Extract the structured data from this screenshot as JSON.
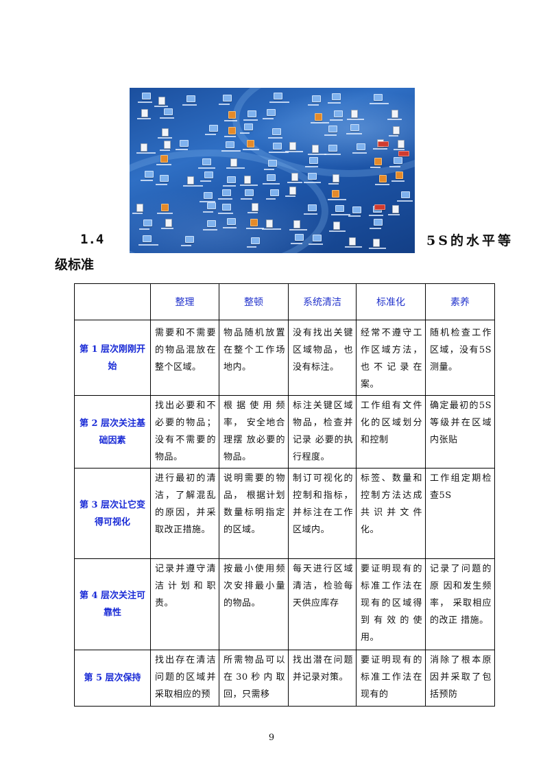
{
  "heading": {
    "number": "1.4",
    "tail": "5S的水平等",
    "line2": "级标准"
  },
  "image": {
    "title": "5S desktop screenshot"
  },
  "table": {
    "headers": [
      "",
      "整理",
      "整顿",
      "系统清洁",
      "标准化",
      "素养"
    ],
    "rows": [
      {
        "level": "第 1 层次刚刚开始",
        "cells": [
          "需要和不需要的物品混放在整个区域。",
          "物品随机放置在整个工作场地内。",
          "没有找出关键区域物品，也没有标注。",
          "经常不遵守工作区域方法，也不记录在案。",
          "随机检查工作区域，没有5S测量。"
        ]
      },
      {
        "level": "第 2 层次关注基础因素",
        "cells": [
          "找出必要和不必要的物品；没有不需要的物品。",
          "根据使用频率， 安全地合理摆 放必要的物品。",
          "标注关键区域物品，检查并记录 必要的执行程度。",
          "工作组有文件化的区域划分和控制",
          "确定最初的5S等级并在区域内张贴"
        ]
      },
      {
        "level": "第 3 层次让它变得可视化",
        "cells": [
          "进行最初的清洁，了解混乱的原因，并采取改正措施。",
          "说明需要的物品， 根据计划数量标明指定的区域。",
          "制订可视化的控制和指标，并标注在工作区域内。",
          "标签、数量和控制方法达成共识并文件化。",
          "工作组定期检查5S"
        ]
      },
      {
        "level": "第 4 层次关注可靠性",
        "cells": [
          "记录并遵守清洁计划和职责。",
          "按最小使用频次安排最小量的物品。",
          "每天进行区域清洁，检验每天供应库存",
          "要证明现有的标准工作法在现有的区域得到有效的使用。",
          "记录了问题的原 因和发生频率， 采取相应的改正 措施。"
        ]
      },
      {
        "level": "第 5 层次保持",
        "cells": [
          "找出存在清洁问题的区域并采取相应的预",
          "所需物品可以在30秒内取回，只需移",
          "找出潜在问题并记录对策。",
          "要证明现有的标准工作法在现有的",
          "消除了根本原因并采取了包括预防"
        ]
      }
    ]
  },
  "page_number": "9"
}
